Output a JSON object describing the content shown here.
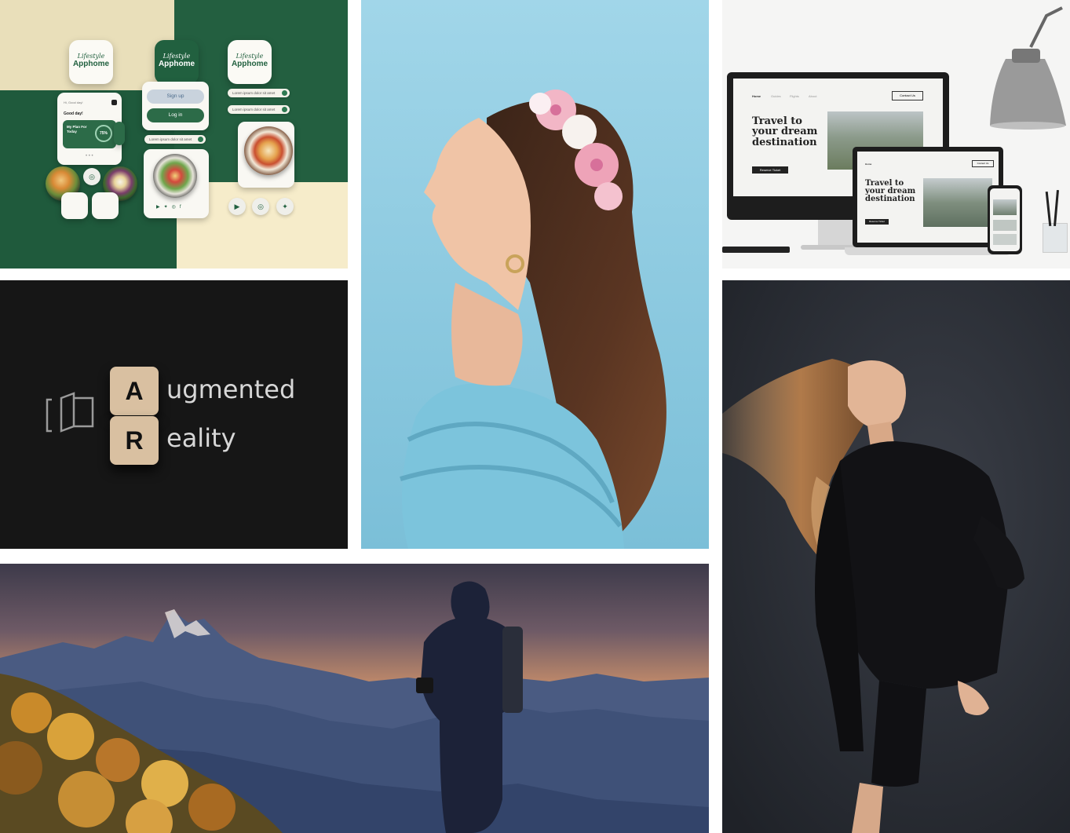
{
  "colors": {
    "background": "#ffffff",
    "apphome_green": "#21603f",
    "apphome_cream": "#f6ecca",
    "ar_background": "#161616",
    "portrait_sky": "#8fcde3",
    "fashion_background": "#2c2f36"
  },
  "apphome": {
    "brand_script": "Lifestyle",
    "brand_name": "Apphome",
    "greeting_small": "Hi, Good day!",
    "greeting": "Good day!",
    "plan_title": "My Plan For Today",
    "plan_progress": "75%",
    "signup_label": "Sign up",
    "login_label": "Log in",
    "field_placeholder": "Lorem ipsum dolor sit amet"
  },
  "ar": {
    "die_1": "A",
    "die_2": "R",
    "word_1": "ugmented",
    "word_2": "eality"
  },
  "travel": {
    "nav_items": [
      "Home",
      "Guides",
      "Flights",
      "About"
    ],
    "contact_button": "Contact Us",
    "headline_line_1": "Travel to",
    "headline_line_2": "your dream",
    "headline_line_3": "destination",
    "cta_button": "Reserve Ticket"
  }
}
